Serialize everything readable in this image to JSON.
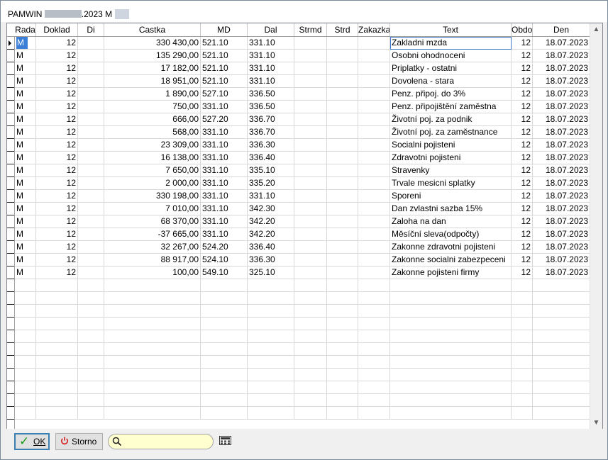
{
  "window": {
    "title_prefix": "PAMWIN",
    "title_suffix": ".2023 M"
  },
  "columns": [
    "Rada",
    "Doklad",
    "Di",
    "Castka",
    "MD",
    "Dal",
    "Strmd",
    "Strd",
    "Zakazka",
    "Text",
    "Obdo",
    "Den"
  ],
  "rows": [
    {
      "rada": "M",
      "doklad": "12",
      "di": "",
      "castka": "330 430,00",
      "md": "521.10",
      "dal": "331.10",
      "strmd": "",
      "strd": "",
      "zakazka": "",
      "text": "Zakladni mzda",
      "obdo": "12",
      "den": "18.07.2023"
    },
    {
      "rada": "M",
      "doklad": "12",
      "di": "",
      "castka": "135 290,00",
      "md": "521.10",
      "dal": "331.10",
      "strmd": "",
      "strd": "",
      "zakazka": "",
      "text": "Osobni ohodnoceni",
      "obdo": "12",
      "den": "18.07.2023"
    },
    {
      "rada": "M",
      "doklad": "12",
      "di": "",
      "castka": "17 182,00",
      "md": "521.10",
      "dal": "331.10",
      "strmd": "",
      "strd": "",
      "zakazka": "",
      "text": "Priplatky - ostatni",
      "obdo": "12",
      "den": "18.07.2023"
    },
    {
      "rada": "M",
      "doklad": "12",
      "di": "",
      "castka": "18 951,00",
      "md": "521.10",
      "dal": "331.10",
      "strmd": "",
      "strd": "",
      "zakazka": "",
      "text": "Dovolena - stara",
      "obdo": "12",
      "den": "18.07.2023"
    },
    {
      "rada": "M",
      "doklad": "12",
      "di": "",
      "castka": "1 890,00",
      "md": "527.10",
      "dal": "336.50",
      "strmd": "",
      "strd": "",
      "zakazka": "",
      "text": "Penz. připoj. do 3%",
      "obdo": "12",
      "den": "18.07.2023"
    },
    {
      "rada": "M",
      "doklad": "12",
      "di": "",
      "castka": "750,00",
      "md": "331.10",
      "dal": "336.50",
      "strmd": "",
      "strd": "",
      "zakazka": "",
      "text": "Penz. připojištění zaměstna",
      "obdo": "12",
      "den": "18.07.2023"
    },
    {
      "rada": "M",
      "doklad": "12",
      "di": "",
      "castka": "666,00",
      "md": "527.20",
      "dal": "336.70",
      "strmd": "",
      "strd": "",
      "zakazka": "",
      "text": "Životní poj. za podnik",
      "obdo": "12",
      "den": "18.07.2023"
    },
    {
      "rada": "M",
      "doklad": "12",
      "di": "",
      "castka": "568,00",
      "md": "331.10",
      "dal": "336.70",
      "strmd": "",
      "strd": "",
      "zakazka": "",
      "text": "Životní poj. za zaměstnance",
      "obdo": "12",
      "den": "18.07.2023"
    },
    {
      "rada": "M",
      "doklad": "12",
      "di": "",
      "castka": "23 309,00",
      "md": "331.10",
      "dal": "336.30",
      "strmd": "",
      "strd": "",
      "zakazka": "",
      "text": "Socialni pojisteni",
      "obdo": "12",
      "den": "18.07.2023"
    },
    {
      "rada": "M",
      "doklad": "12",
      "di": "",
      "castka": "16 138,00",
      "md": "331.10",
      "dal": "336.40",
      "strmd": "",
      "strd": "",
      "zakazka": "",
      "text": "Zdravotni pojisteni",
      "obdo": "12",
      "den": "18.07.2023"
    },
    {
      "rada": "M",
      "doklad": "12",
      "di": "",
      "castka": "7 650,00",
      "md": "331.10",
      "dal": "335.10",
      "strmd": "",
      "strd": "",
      "zakazka": "",
      "text": "Stravenky",
      "obdo": "12",
      "den": "18.07.2023"
    },
    {
      "rada": "M",
      "doklad": "12",
      "di": "",
      "castka": "2 000,00",
      "md": "331.10",
      "dal": "335.20",
      "strmd": "",
      "strd": "",
      "zakazka": "",
      "text": "Trvale mesicni splatky",
      "obdo": "12",
      "den": "18.07.2023"
    },
    {
      "rada": "M",
      "doklad": "12",
      "di": "",
      "castka": "330 198,00",
      "md": "331.10",
      "dal": "331.10",
      "strmd": "",
      "strd": "",
      "zakazka": "",
      "text": "Sporeni",
      "obdo": "12",
      "den": "18.07.2023"
    },
    {
      "rada": "M",
      "doklad": "12",
      "di": "",
      "castka": "7 010,00",
      "md": "331.10",
      "dal": "342.30",
      "strmd": "",
      "strd": "",
      "zakazka": "",
      "text": "Dan zvlastni sazba 15%",
      "obdo": "12",
      "den": "18.07.2023"
    },
    {
      "rada": "M",
      "doklad": "12",
      "di": "",
      "castka": "68 370,00",
      "md": "331.10",
      "dal": "342.20",
      "strmd": "",
      "strd": "",
      "zakazka": "",
      "text": "Zaloha na dan",
      "obdo": "12",
      "den": "18.07.2023"
    },
    {
      "rada": "M",
      "doklad": "12",
      "di": "",
      "castka": "-37 665,00",
      "md": "331.10",
      "dal": "342.20",
      "strmd": "",
      "strd": "",
      "zakazka": "",
      "text": "Měsíční sleva(odpočty)",
      "obdo": "12",
      "den": "18.07.2023"
    },
    {
      "rada": "M",
      "doklad": "12",
      "di": "",
      "castka": "32 267,00",
      "md": "524.20",
      "dal": "336.40",
      "strmd": "",
      "strd": "",
      "zakazka": "",
      "text": "Zakonne zdravotni pojisteni",
      "obdo": "12",
      "den": "18.07.2023"
    },
    {
      "rada": "M",
      "doklad": "12",
      "di": "",
      "castka": "88 917,00",
      "md": "524.10",
      "dal": "336.30",
      "strmd": "",
      "strd": "",
      "zakazka": "",
      "text": "Zakonne socialni zabezpeceni",
      "obdo": "12",
      "den": "18.07.2023"
    },
    {
      "rada": "M",
      "doklad": "12",
      "di": "",
      "castka": "100,00",
      "md": "549.10",
      "dal": "325.10",
      "strmd": "",
      "strd": "",
      "zakazka": "",
      "text": "Zakonne pojisteni firmy",
      "obdo": "12",
      "den": "18.07.2023"
    }
  ],
  "empty_rows": 11,
  "selected_row": 0,
  "buttons": {
    "ok_label": "OK",
    "storno_label": "Storno"
  },
  "search": {
    "value": ""
  },
  "icons": {
    "ok": "checkmark-icon",
    "storno": "power-icon",
    "search": "search-icon",
    "calculator": "calculator-icon",
    "scroll_up": "chevron-up-icon",
    "scroll_down": "chevron-down-icon",
    "row_indicator": "row-pointer-icon"
  },
  "colors": {
    "selection": "#3b7fd6",
    "search_bg": "#ffffd0",
    "ok_check": "#1a9a1a",
    "storno_power": "#d42020"
  }
}
